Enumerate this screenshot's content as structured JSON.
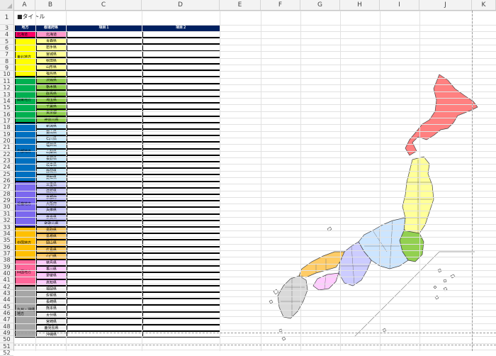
{
  "sheet": {
    "column_headers": [
      "A",
      "B",
      "C",
      "D",
      "E",
      "F",
      "G",
      "H",
      "I",
      "J",
      "K"
    ],
    "row_headers": [
      "1",
      "3",
      "4",
      "5",
      "6",
      "7",
      "8",
      "9",
      "10",
      "11",
      "12",
      "13",
      "14",
      "15",
      "16",
      "17",
      "18",
      "19",
      "20",
      "21",
      "22",
      "23",
      "24",
      "25",
      "26",
      "27",
      "28",
      "29",
      "30",
      "31",
      "32",
      "33",
      "34",
      "35",
      "36",
      "37",
      "38",
      "39",
      "40",
      "41",
      "42",
      "43",
      "44",
      "45",
      "46",
      "47",
      "48",
      "49",
      "50",
      "51",
      "52"
    ],
    "title_cell": "■タイトル"
  },
  "table": {
    "headers": [
      "地方",
      "都道府県",
      "項目１",
      "項目２"
    ],
    "regions": [
      {
        "name": "北海道",
        "color": "#ff0066",
        "prefs": [
          "北海道"
        ],
        "pref_color": "#ff99cc"
      },
      {
        "name": "東北地方",
        "color": "#ffff00",
        "prefs": [
          "青森県",
          "岩手県",
          "宮城県",
          "秋田県",
          "山形県",
          "福島県"
        ],
        "pref_color": "#ffff99"
      },
      {
        "name": "関東地方",
        "color": "#00b050",
        "prefs": [
          "茨城県",
          "栃木県",
          "群馬県",
          "埼玉県",
          "千葉県",
          "東京都",
          "神奈川県"
        ],
        "pref_color": "#92d050"
      },
      {
        "name": "中部地方",
        "color": "#0070c0",
        "prefs": [
          "新潟県",
          "富山県",
          "石川県",
          "福井県",
          "山梨県",
          "長野県",
          "岐阜県",
          "静岡県",
          "愛知県"
        ],
        "pref_color": "#ccecff"
      },
      {
        "name": "近畿地方",
        "color": "#7b68ee",
        "prefs": [
          "三重県",
          "滋賀県",
          "京都府",
          "大阪府",
          "兵庫県",
          "奈良県",
          "和歌山県"
        ],
        "pref_color": "#ccccff"
      },
      {
        "name": "中国地方",
        "color": "#ffc000",
        "prefs": [
          "鳥取県",
          "島根県",
          "岡山県",
          "広島県",
          "山口県"
        ],
        "pref_color": "#ffcc66"
      },
      {
        "name": "四国地方",
        "color": "#ff6699",
        "prefs": [
          "徳島県",
          "香川県",
          "愛媛県",
          "高知県"
        ],
        "pref_color": "#ffccff"
      },
      {
        "name": "九州・沖縄地方",
        "color": "#a6a6a6",
        "prefs": [
          "福岡県",
          "佐賀県",
          "長崎県",
          "熊本県",
          "大分県",
          "宮崎県",
          "鹿児島県",
          "沖縄県"
        ],
        "pref_color": "#f2f2f2"
      }
    ]
  },
  "map": {
    "colors": {
      "hokkaido": "#ff8080",
      "tohoku": "#ffff99",
      "kanto": "#92d050",
      "chubu": "#cce5ff",
      "kinki": "#ccccff",
      "chugoku": "#ffcc66",
      "shikoku": "#ffccff",
      "kyushu": "#d9d9d9"
    }
  }
}
